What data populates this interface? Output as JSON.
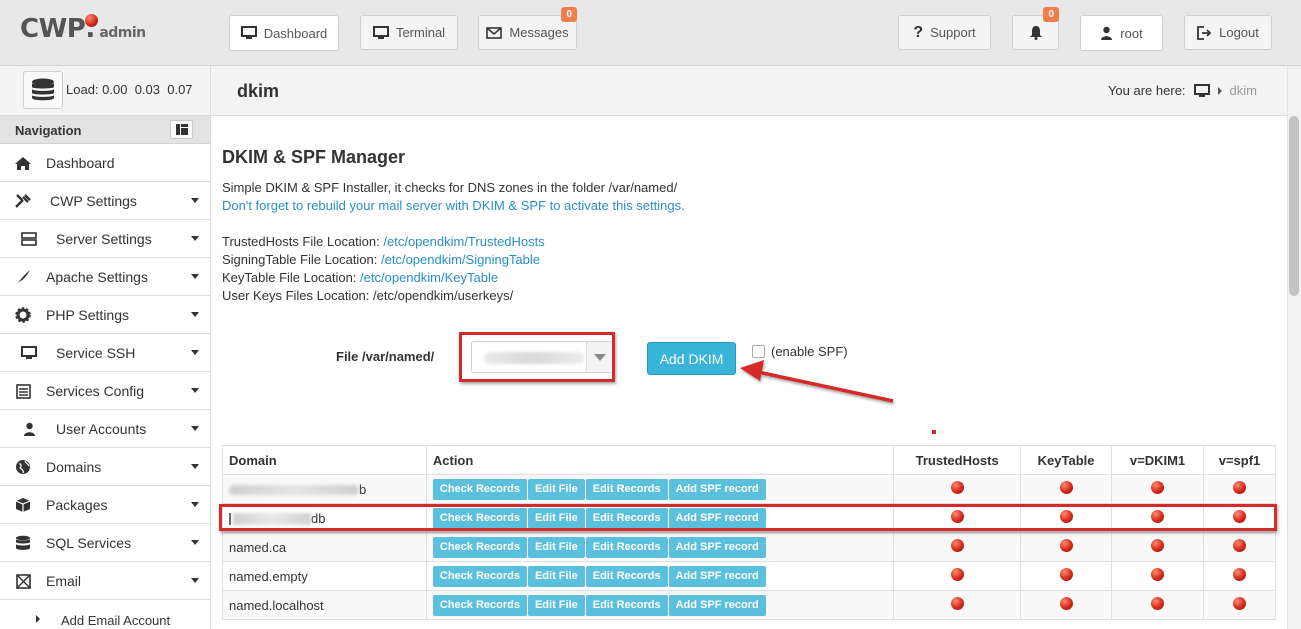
{
  "logo": {
    "main": "CWP",
    "sub": "admin"
  },
  "topbar": {
    "dashboard": "Dashboard",
    "terminal": "Terminal",
    "messages": "Messages",
    "messages_count": "0",
    "support": "Support",
    "notifications_count": "0",
    "user": "root",
    "logout": "Logout"
  },
  "sidebar": {
    "load_label": "Load:",
    "load_values": "0.00  0.03  0.07",
    "nav_title": "Navigation",
    "items": [
      {
        "label": "Dashboard",
        "icon": "home-icon",
        "has_sub": false
      },
      {
        "label": "CWP Settings",
        "icon": "tools-icon",
        "has_sub": true
      },
      {
        "label": "Server Settings",
        "icon": "server-icon",
        "has_sub": true
      },
      {
        "label": "Apache Settings",
        "icon": "feather-icon",
        "has_sub": true
      },
      {
        "label": "PHP Settings",
        "icon": "gear-icon",
        "has_sub": true
      },
      {
        "label": "Service SSH",
        "icon": "monitor-icon",
        "has_sub": true
      },
      {
        "label": "Services Config",
        "icon": "config-icon",
        "has_sub": true
      },
      {
        "label": "User Accounts",
        "icon": "user-icon",
        "has_sub": true
      },
      {
        "label": "Domains",
        "icon": "globe-icon",
        "has_sub": true
      },
      {
        "label": "Packages",
        "icon": "package-icon",
        "has_sub": true
      },
      {
        "label": "SQL Services",
        "icon": "database-icon",
        "has_sub": true
      },
      {
        "label": "Email",
        "icon": "envelope-icon",
        "has_sub": true
      }
    ],
    "sub_items": [
      {
        "label": "Add Email Account"
      }
    ]
  },
  "header": {
    "title": "dkim",
    "breadcrumb_label": "You are here:",
    "breadcrumb_current": "dkim"
  },
  "content": {
    "title": "DKIM & SPF Manager",
    "intro": "Simple DKIM & SPF Installer, it checks for DNS zones in the folder /var/named/",
    "rebuild_note": "Don't forget to rebuild your mail server with DKIM & SPF to activate this settings.",
    "locations": [
      {
        "label": "TrustedHosts File Location:",
        "value": "/etc/opendkim/TrustedHosts",
        "link": true
      },
      {
        "label": "SigningTable File Location:",
        "value": "/etc/opendkim/SigningTable",
        "link": true
      },
      {
        "label": "KeyTable File Location:",
        "value": "/etc/opendkim/KeyTable",
        "link": true
      },
      {
        "label": "User Keys Files Location:",
        "value": "/etc/opendkim/userkeys/",
        "link": false
      }
    ],
    "file_label": "File /var/named/",
    "add_button": "Add DKIM",
    "enable_spf": "(enable SPF)"
  },
  "table": {
    "headers": [
      "Domain",
      "Action",
      "TrustedHosts",
      "KeyTable",
      "v=DKIM1",
      "v=spf1"
    ],
    "actions": [
      "Check Records",
      "Edit File",
      "Edit Records",
      "Add SPF record"
    ],
    "rows": [
      {
        "domain": "b",
        "blurred": "long"
      },
      {
        "domain": "db",
        "blurred": "short"
      },
      {
        "domain": "named.ca",
        "blurred": "none"
      },
      {
        "domain": "named.empty",
        "blurred": "none"
      },
      {
        "domain": "named.localhost",
        "blurred": "none"
      }
    ]
  },
  "colors": {
    "accent": "#5bc0de",
    "link": "#2a8fc7",
    "badge": "#f07e4d",
    "highlight": "#d42a2a"
  }
}
